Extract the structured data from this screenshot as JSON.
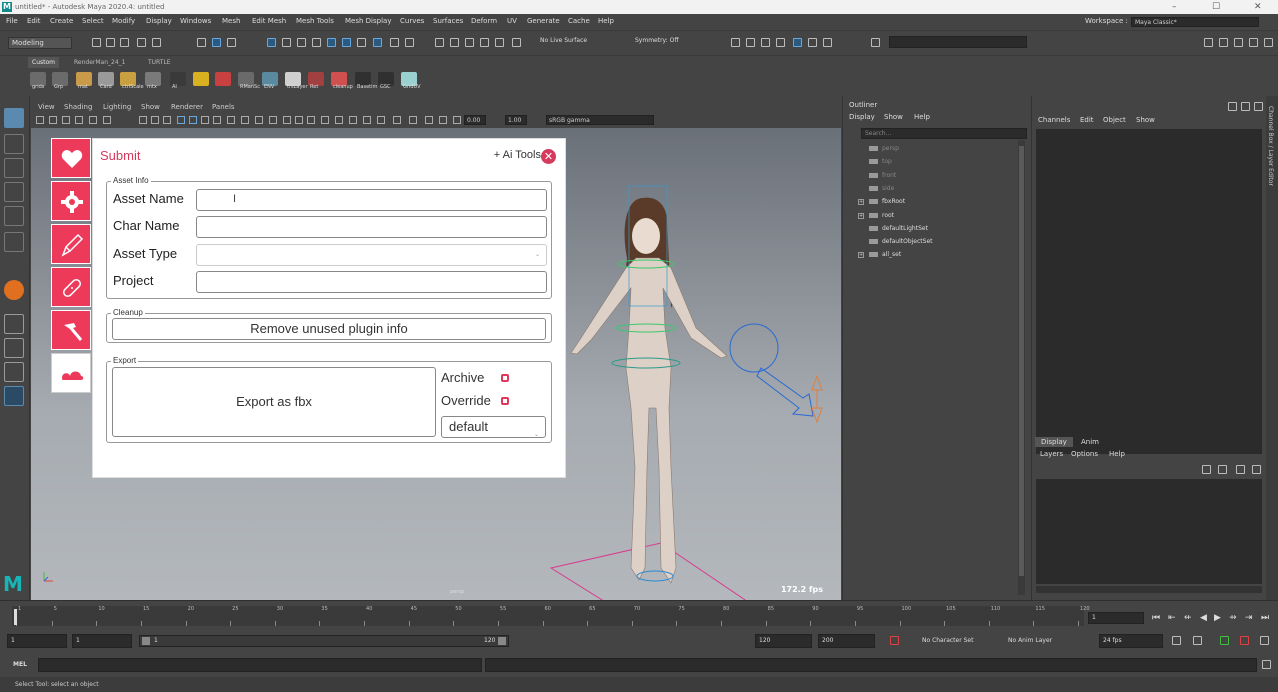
{
  "titlebar": {
    "text": "untitled* - Autodesk Maya 2020.4: untitled",
    "min": "–",
    "max": "☐",
    "close": "✕"
  },
  "menu": [
    "File",
    "Edit",
    "Create",
    "Select",
    "Modify",
    "Display",
    "Windows",
    "Mesh",
    "Edit Mesh",
    "Mesh Tools",
    "Mesh Display",
    "Curves",
    "Surfaces",
    "Deform",
    "UV",
    "Generate",
    "Cache",
    "Help"
  ],
  "workspace": {
    "label": "Workspace :",
    "value": "Maya Classic*"
  },
  "statusline": {
    "mode": "Modeling",
    "live_surface": "No Live Surface",
    "symmetry": "Symmetry: Off"
  },
  "shelf": {
    "tabs": [
      "Custom",
      "RenderMan_24_1",
      "TURTLE"
    ],
    "icons": [
      {
        "label": "grids",
        "color": "#6b6b6b"
      },
      {
        "label": "Grp",
        "color": "#6b6b6b"
      },
      {
        "label": "mat",
        "color": "#c89a4a"
      },
      {
        "label": "Card",
        "color": "#9a9a9a"
      },
      {
        "label": "ctrlScale",
        "color": "#c8a040"
      },
      {
        "label": "mtx",
        "color": "#7a7a7a"
      },
      {
        "label": "AI",
        "color": "#3a3a3a"
      },
      {
        "label": "",
        "color": "#d8b020"
      },
      {
        "label": "",
        "color": "#c84040"
      },
      {
        "label": "RManSc",
        "color": "#6a6a6a"
      },
      {
        "label": "ENV",
        "color": "#5a8aa0"
      },
      {
        "label": "trsLayer",
        "color": "#d0d0d0"
      },
      {
        "label": "Ret",
        "color": "#a04040"
      },
      {
        "label": "cleanup",
        "color": "#d05050"
      },
      {
        "label": "Basetim",
        "color": "#303030"
      },
      {
        "label": "GSC",
        "color": "#303030"
      },
      {
        "label": "GridUV",
        "color": "#9ad0d0"
      }
    ]
  },
  "viewport": {
    "menu": [
      "View",
      "Shading",
      "Lighting",
      "Show",
      "Renderer",
      "Panels"
    ],
    "near": "0.00",
    "far": "1.00",
    "colorspace": "sRGB gamma",
    "fps": "172.2 fps",
    "camera": "persp"
  },
  "tool": {
    "title": "Submit",
    "ai_tools": "+ Ai Tools",
    "close": "✕",
    "asset_info": {
      "group": "Asset Info",
      "asset_name_label": "Asset Name",
      "asset_name_value": "",
      "char_name_label": "Char Name",
      "char_name_value": "",
      "asset_type_label": "Asset Type",
      "asset_type_value": "",
      "project_label": "Project",
      "project_value": ""
    },
    "cleanup": {
      "group": "Cleanup",
      "button": "Remove unused plugin info"
    },
    "export": {
      "group": "Export",
      "button": "Export as fbx",
      "archive": "Archive",
      "override": "Override",
      "dropdown": "default"
    }
  },
  "outliner": {
    "title": "Outliner",
    "menu": [
      "Display",
      "Show",
      "Help"
    ],
    "search": "Search...",
    "items": [
      {
        "label": "persp",
        "dim": true,
        "expand": false
      },
      {
        "label": "top",
        "dim": true,
        "expand": false
      },
      {
        "label": "front",
        "dim": true,
        "expand": false
      },
      {
        "label": "side",
        "dim": true,
        "expand": false
      },
      {
        "label": "fbxRoot",
        "dim": false,
        "expand": true
      },
      {
        "label": "root",
        "dim": false,
        "expand": true
      },
      {
        "label": "defaultLightSet",
        "dim": false,
        "expand": false
      },
      {
        "label": "defaultObjectSet",
        "dim": false,
        "expand": false
      },
      {
        "label": "all_set",
        "dim": false,
        "expand": true
      }
    ]
  },
  "channelbox": {
    "menu": [
      "Channels",
      "Edit",
      "Object",
      "Show"
    ],
    "layer_tabs": [
      "Display",
      "Anim"
    ],
    "layer_menu": [
      "Layers",
      "Options",
      "Help"
    ],
    "side_label": "Channel Box / Layer Editor"
  },
  "timeline": {
    "ticks": [
      "1",
      "5",
      "10",
      "15",
      "20",
      "25",
      "30",
      "35",
      "40",
      "45",
      "50",
      "55",
      "60",
      "65",
      "70",
      "75",
      "80",
      "85",
      "90",
      "95",
      "100",
      "105",
      "110",
      "115",
      "120"
    ],
    "current": "1"
  },
  "range": {
    "start": "1",
    "anim_start": "1",
    "slider_start": "1",
    "slider_end": "120",
    "end": "120",
    "anim_end": "200",
    "char_set": "No Character Set",
    "anim_layer": "No Anim Layer",
    "fps": "24 fps"
  },
  "cmdline": {
    "lang": "MEL"
  },
  "help": {
    "text": "Select Tool: select an object"
  }
}
